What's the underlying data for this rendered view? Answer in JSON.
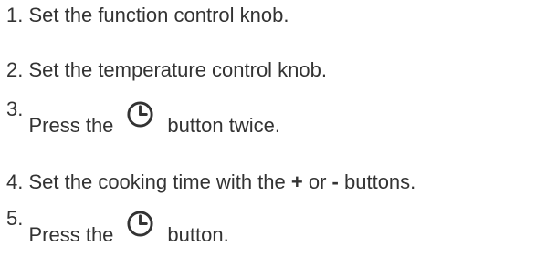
{
  "steps": [
    {
      "number": "1.",
      "text": "Set the function control knob."
    },
    {
      "number": "2.",
      "text": "Set the temperature control knob."
    },
    {
      "number": "3.",
      "before": "Press the",
      "icon": "clock-icon",
      "after": "button twice."
    },
    {
      "number": "4.",
      "before": "Set the cooking time with the",
      "plus": "+",
      "or": "or",
      "minus": "-",
      "after": "buttons."
    },
    {
      "number": "5.",
      "before": "Press the",
      "icon": "clock-icon",
      "after": "button."
    }
  ],
  "colors": {
    "text": "#333333",
    "icon": "#333333",
    "background": "#ffffff"
  }
}
